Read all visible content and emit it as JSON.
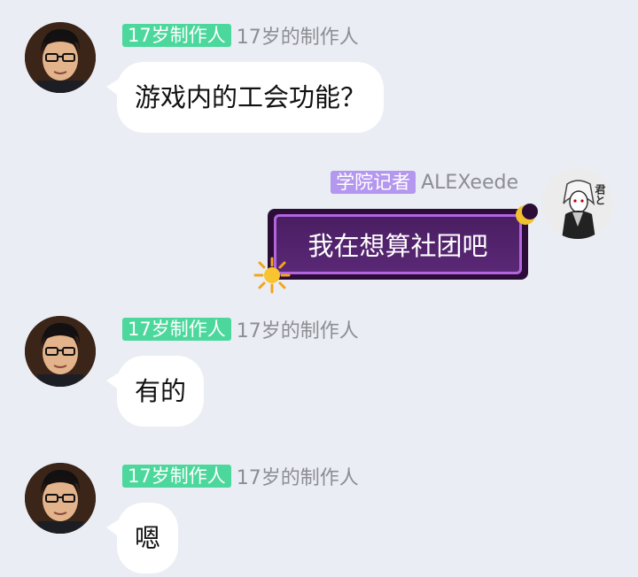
{
  "messages": [
    {
      "sender": {
        "badge": "17岁制作人",
        "nickname": "17岁的制作人"
      },
      "text": "游戏内的工会功能？"
    },
    {
      "sender": {
        "badge": "学院记者",
        "nickname": "ALEXeede"
      },
      "text": "我在想算社团吧"
    },
    {
      "sender": {
        "badge": "17岁制作人",
        "nickname": "17岁的制作人"
      },
      "text": "有的"
    },
    {
      "sender": {
        "badge": "17岁制作人",
        "nickname": "17岁的制作人"
      },
      "text": "嗯"
    }
  ],
  "avatar_mark": "君と",
  "colors": {
    "background": "#eaedf4",
    "badge_green": "#4cd89c",
    "badge_purple": "#b497ee",
    "fancy_bubble": "#4a1e62"
  }
}
